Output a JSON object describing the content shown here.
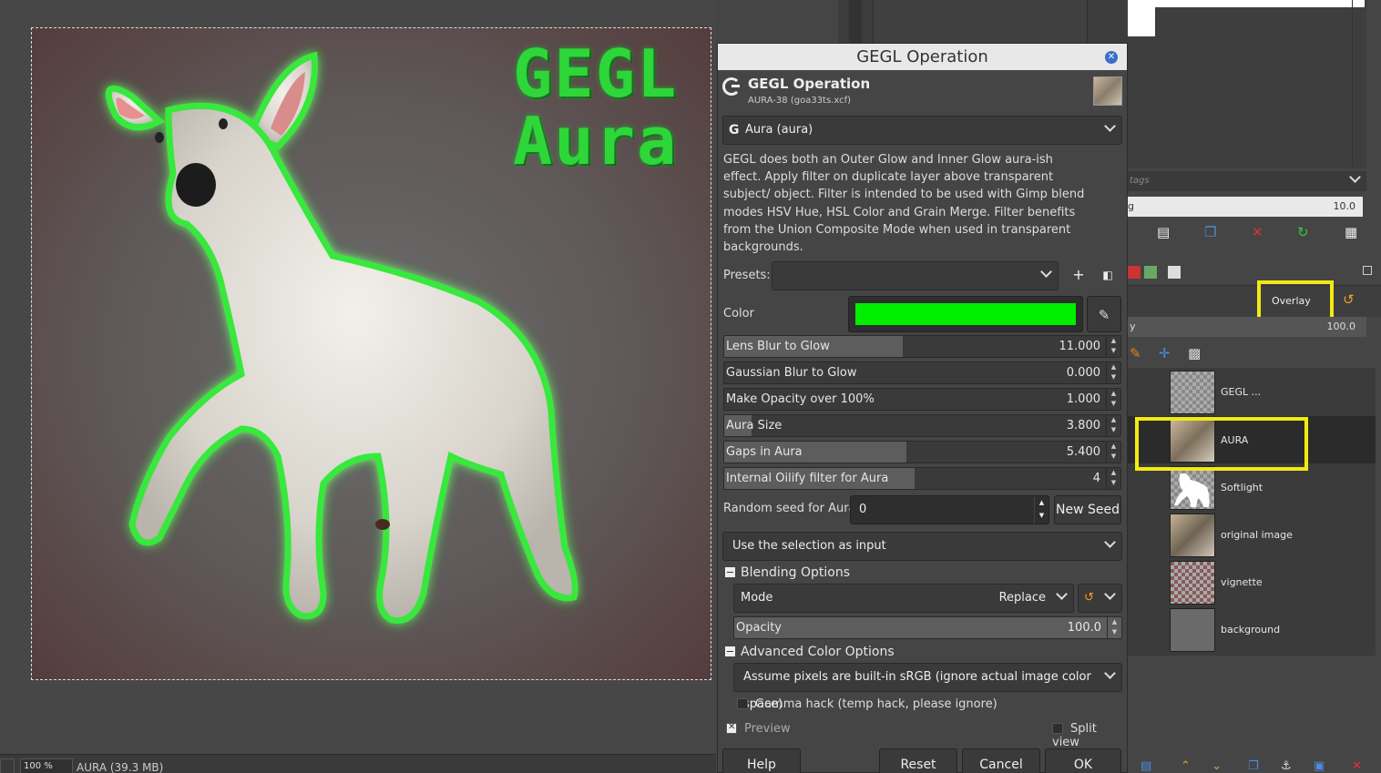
{
  "canvas": {
    "title_line1": "GEGL",
    "title_line2": "Aura",
    "zoom": "100 %",
    "image_info": "AURA (39.3 MB)"
  },
  "dialog": {
    "window_title": "GEGL Operation",
    "header_title": "GEGL Operation",
    "header_subtitle": "AURA-38 (goa33ts.xcf)",
    "operation": "Aura (aura)",
    "description": "GEGL does both an Outer Glow and Inner Glow aura-ish effect. Apply filter on duplicate layer above transparent subject/ object. Filter is intended to be used with Gimp blend modes HSV Hue, HSL Color and Grain Merge. Filter benefits from the Union Composite Mode when used in transparent backgrounds.",
    "presets_label": "Presets:",
    "color_label": "Color",
    "color_value": "#00ee00",
    "sliders": [
      {
        "label": "Lens Blur to Glow",
        "value": "11.000",
        "fill": 0.45
      },
      {
        "label": "Gaussian Blur to Glow",
        "value": "0.000",
        "fill": 0.0
      },
      {
        "label": "Make Opacity over 100%",
        "value": "1.000",
        "fill": 0.0
      },
      {
        "label": "Aura Size",
        "value": "3.800",
        "fill": 0.07
      },
      {
        "label": "Gaps in Aura",
        "value": "5.400",
        "fill": 0.46
      },
      {
        "label": "Internal Oilify filter for Aura",
        "value": "4",
        "fill": 0.48
      }
    ],
    "seed_label": "Random seed for Aura",
    "seed_value": "0",
    "new_seed": "New Seed",
    "input_select": "Use the selection as input",
    "blending_section": "Blending Options",
    "mode_label": "Mode",
    "mode_value": "Replace",
    "opacity_label": "Opacity",
    "opacity_value": "100.0",
    "adv_section": "Advanced Color Options",
    "color_space": "Assume pixels are built-in sRGB (ignore actual image color space)",
    "gamma_hack": "Gamma hack (temp hack, please ignore)",
    "preview": "Preview",
    "split_view": "Split view",
    "buttons": {
      "help": "Help",
      "reset": "Reset",
      "cancel": "Cancel",
      "ok": "OK"
    }
  },
  "right_panel": {
    "tags_placeholder": "tags",
    "spacing_label": "g",
    "spacing_value": "10.0",
    "layer_mode": "Overlay",
    "opacity_label": "y",
    "opacity_value": "100.0",
    "layers": [
      {
        "name": "GEGL ..."
      },
      {
        "name": "AURA"
      },
      {
        "name": "Softlight"
      },
      {
        "name": "original image"
      },
      {
        "name": "vignette"
      },
      {
        "name": "background"
      }
    ],
    "colors": {
      "highlight": "#f2ea10"
    }
  }
}
